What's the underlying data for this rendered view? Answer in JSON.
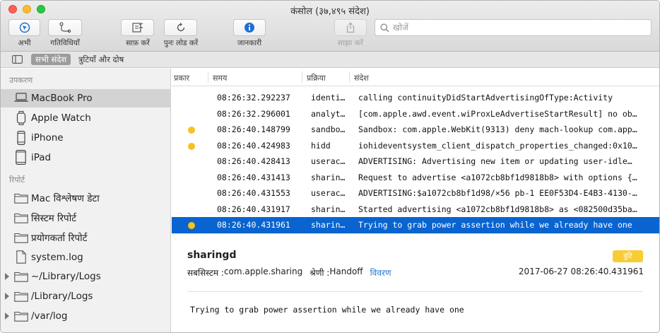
{
  "window": {
    "title": "कंसोल (३७,४९५ संदेश)"
  },
  "toolbar": {
    "now_label": "अभी",
    "activities_label": "गतिविधियाँ",
    "clear_label": "साफ़ करें",
    "reload_label": "पुनः लोड करें",
    "info_label": "जानकारी",
    "share_label": "साझा करें",
    "search_placeholder": "खोजें"
  },
  "filterbar": {
    "all_messages": "सभी संदेश",
    "errors_and_faults": "त्रुटियाँ और दोष"
  },
  "sidebar": {
    "devices_header": "उपकरण",
    "devices": [
      {
        "label": "MacBook Pro",
        "icon": "laptop-icon",
        "selected": true
      },
      {
        "label": "Apple Watch",
        "icon": "watch-icon"
      },
      {
        "label": "iPhone",
        "icon": "iphone-icon"
      },
      {
        "label": "iPad",
        "icon": "ipad-icon"
      }
    ],
    "reports_header": "रिपोर्ट",
    "reports": [
      {
        "label": "Mac विश्लेषण डेटा",
        "icon": "folder-icon"
      },
      {
        "label": "सिस्टम रिपोर्ट",
        "icon": "folder-icon"
      },
      {
        "label": "प्रयोगकर्ता रिपोर्ट",
        "icon": "folder-icon"
      },
      {
        "label": "system.log",
        "icon": "document-icon"
      },
      {
        "label": "~/Library/Logs",
        "icon": "folder-icon"
      },
      {
        "label": "/Library/Logs",
        "icon": "folder-icon"
      },
      {
        "label": "/var/log",
        "icon": "folder-icon"
      }
    ]
  },
  "table": {
    "columns": {
      "type": "प्रकार",
      "time": "समय",
      "process": "प्रक्रिया",
      "message": "संदेश"
    },
    "rows": [
      {
        "dot": false,
        "time": "08:26:32.292237",
        "process": "identi…",
        "message": "calling continuityDidStartAdvertisingOfType:Activity"
      },
      {
        "dot": false,
        "time": "08:26:32.296001",
        "process": "analyt…",
        "message": "[com.apple.awd.event.wiProxLeAdvertiseStartResult] no ob…"
      },
      {
        "dot": true,
        "time": "08:26:40.148799",
        "process": "sandbo…",
        "message": "Sandbox: com.apple.WebKit(9313) deny mach-lookup com.app…"
      },
      {
        "dot": true,
        "time": "08:26:40.424983",
        "process": "hidd",
        "message": "iohideventsystem_client_dispatch_properties_changed:0x10…"
      },
      {
        "dot": false,
        "time": "08:26:40.428413",
        "process": "userac…",
        "message": "ADVERTISING: Advertising new item or updating user-idle…"
      },
      {
        "dot": false,
        "time": "08:26:40.431413",
        "process": "sharin…",
        "message": "Request to advertise <a1072cb8bf1d9818b8> with options {…"
      },
      {
        "dot": false,
        "time": "08:26:40.431553",
        "process": "userac…",
        "message": "ADVERTISING:$a1072cb8bf1d98/⨯56 pb-1 EE0F53D4-E4B3-4130-…"
      },
      {
        "dot": false,
        "time": "08:26:40.431917",
        "process": "sharin…",
        "message": "Started advertising <a1072cb8bf1d9818b8> as <082500d35ba…"
      },
      {
        "dot": true,
        "time": "08:26:40.431961",
        "process": "sharin…",
        "message": "Trying to grab power assertion while we already have one",
        "selected": true
      }
    ]
  },
  "detail": {
    "process": "sharingd",
    "badge": "त्रुटि",
    "subsystem_label": "सबसिस्टम : ",
    "subsystem": "com.apple.sharing",
    "category_label": "श्रेणी : ",
    "category": "Handoff",
    "details_link": "विवरण",
    "timestamp": "2017-06-27 08:26:40.431961",
    "message": "Trying to grab power assertion while we already have one"
  },
  "colors": {
    "selection": "#0a64d0",
    "warning_dot": "#f6c21b",
    "badge": "#f7cd36",
    "link": "#1f77d6"
  }
}
